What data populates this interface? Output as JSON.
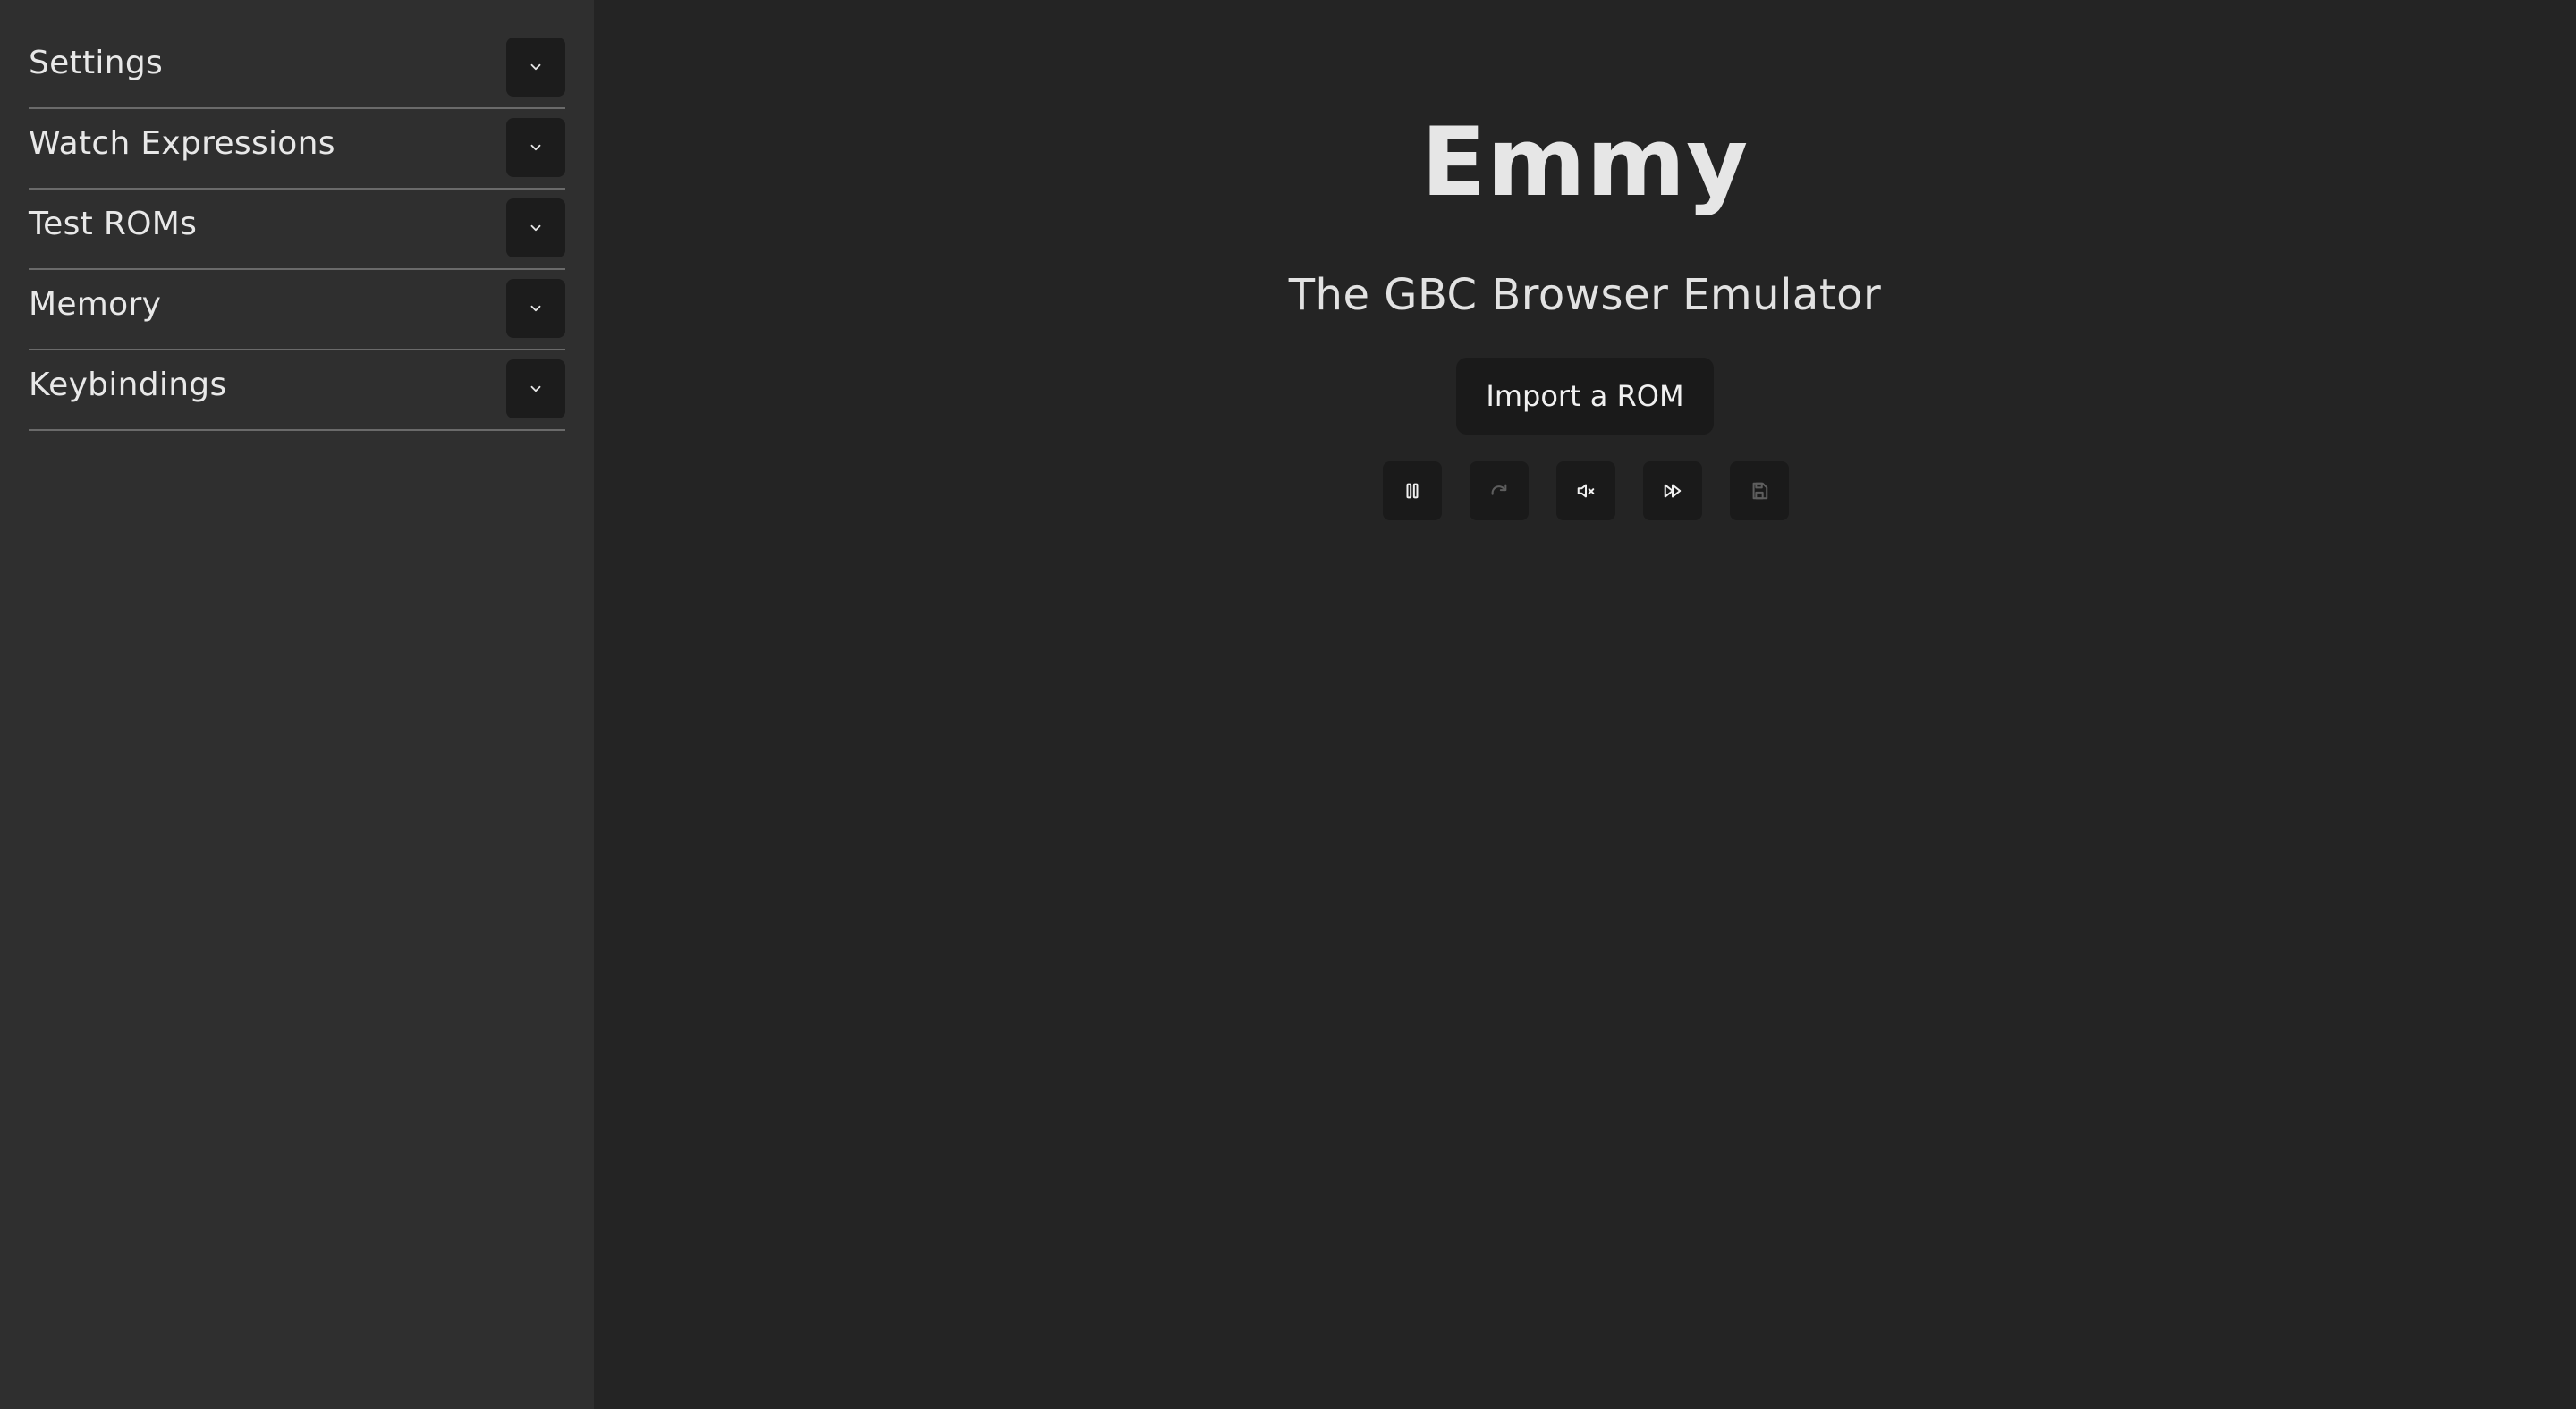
{
  "sidebar": {
    "items": [
      {
        "label": "Settings",
        "icon": "chevron-down-icon"
      },
      {
        "label": "Watch Expressions",
        "icon": "chevron-down-icon"
      },
      {
        "label": "Test ROMs",
        "icon": "chevron-down-icon"
      },
      {
        "label": "Memory",
        "icon": "chevron-down-icon"
      },
      {
        "label": "Keybindings",
        "icon": "chevron-down-icon"
      }
    ]
  },
  "main": {
    "title": "Emmy",
    "subtitle": "The GBC Browser Emulator",
    "import_button": "Import a ROM",
    "controls": [
      {
        "name": "pause",
        "icon": "pause-icon",
        "enabled": true
      },
      {
        "name": "restart",
        "icon": "redo-icon",
        "enabled": false
      },
      {
        "name": "mute",
        "icon": "mute-icon",
        "enabled": true
      },
      {
        "name": "fast-forward",
        "icon": "fast-forward-icon",
        "enabled": true
      },
      {
        "name": "save",
        "icon": "save-icon",
        "enabled": false
      }
    ]
  },
  "colors": {
    "sidebar_bg": "#2f2f2f",
    "main_bg": "#242424",
    "button_bg": "#1a1a1a",
    "text": "#e6e6e6"
  }
}
